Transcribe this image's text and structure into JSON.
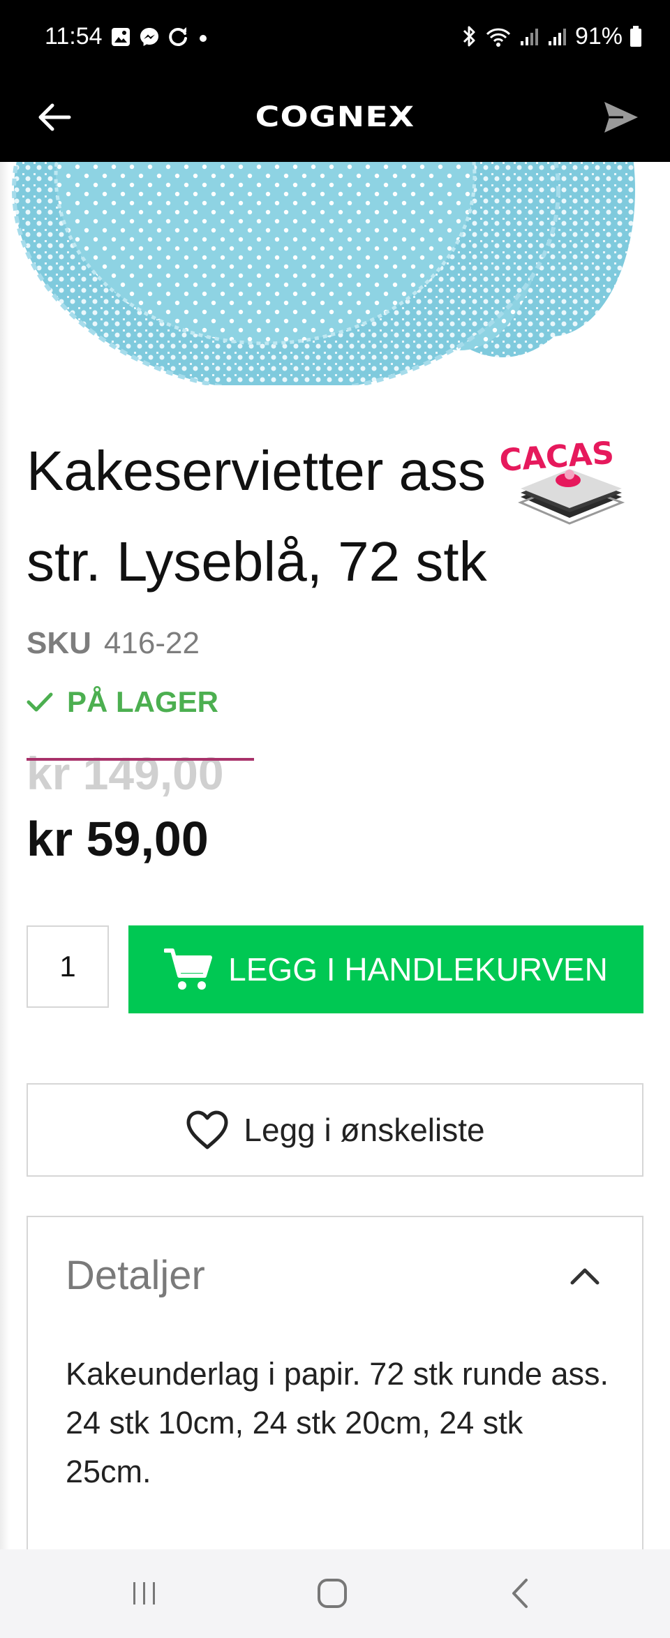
{
  "status_bar": {
    "time": "11:54",
    "battery": "91%"
  },
  "header": {
    "brand": "COGNEX"
  },
  "product": {
    "title_line1": "Kakeservietter ass",
    "title_line2": "str. Lyseblå, 72 stk",
    "brand_badge": "CACAS",
    "sku_label": "SKU",
    "sku_value": "416-22",
    "stock_status": "PÅ LAGER",
    "old_price": "kr 149,00",
    "price": "kr 59,00",
    "quantity": "1",
    "add_to_cart_label": "LEGG I HANDLEKURVEN",
    "wishlist_label": "Legg i ønskeliste"
  },
  "details": {
    "title": "Detaljer",
    "expanded": true,
    "line1": "Kakeunderlag i papir. 72 stk runde ass.",
    "line2": "24 stk 10cm, 24 stk 20cm, 24 stk 25cm."
  },
  "colors": {
    "bar_black": "#000000",
    "cart_green": "#00c853",
    "stock_green": "#4caf50",
    "strike_magenta": "#a8326a",
    "badge_pink": "#e6195c",
    "doily_blue": "#8fd6e6"
  },
  "icons": {
    "back": "arrow-left-icon",
    "share": "send-icon",
    "stock": "check-icon",
    "cart": "shopping-cart-icon",
    "wishlist": "heart-icon",
    "details_toggle": "chevron-up-icon",
    "nav_recents": "recents-icon",
    "nav_home": "home-icon",
    "nav_back": "back-icon"
  }
}
